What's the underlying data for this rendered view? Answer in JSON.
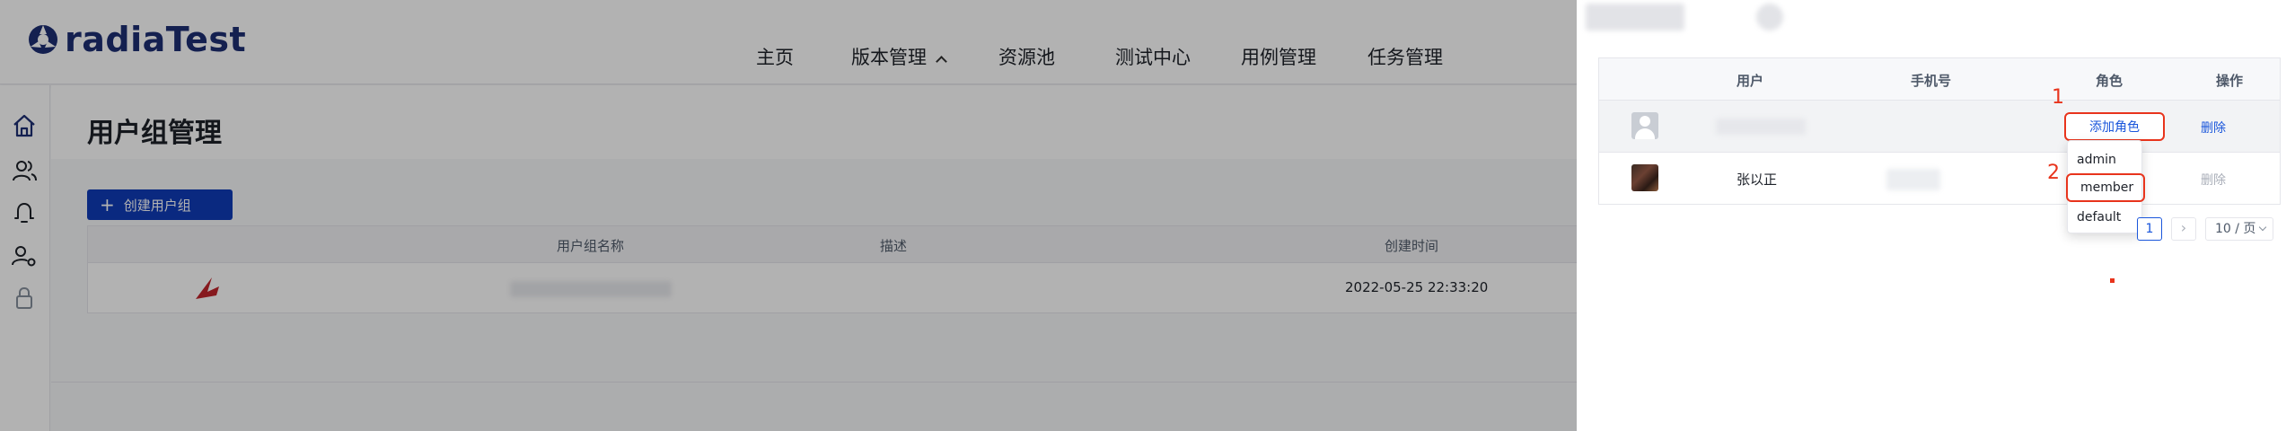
{
  "app": {
    "logo_text": "radiaTest",
    "brand_color": "#1d2e73",
    "accent_color": "#1a56db",
    "highlight_color": "#e8341c"
  },
  "nav": {
    "items": [
      {
        "label": "主页"
      },
      {
        "label": "版本管理",
        "has_caret": true
      },
      {
        "label": "资源池"
      },
      {
        "label": "测试中心"
      },
      {
        "label": "用例管理"
      },
      {
        "label": "任务管理"
      }
    ]
  },
  "sidebar": {
    "icons": [
      "home-icon",
      "users-icon",
      "bell-icon",
      "user-settings-icon",
      "lock-icon"
    ]
  },
  "page": {
    "title": "用户组管理",
    "create_button": "创建用户组",
    "table": {
      "columns": [
        "用户组名称",
        "描述",
        "创建时间"
      ],
      "rows": [
        {
          "created_at": "2022-05-25 22:33:20"
        }
      ]
    }
  },
  "drawer": {
    "table": {
      "columns": [
        "用户",
        "手机号",
        "角色",
        "操作"
      ],
      "rows": [
        {
          "name": "",
          "role_action": "添加角色",
          "action": "删除",
          "action_enabled": true,
          "avatar": "default-avatar-icon"
        },
        {
          "name": "张以正",
          "role_action": "",
          "action": "删除",
          "action_enabled": false,
          "avatar": "user-photo-avatar"
        }
      ]
    },
    "role_dropdown": {
      "options": [
        "admin",
        "member",
        "default"
      ],
      "highlighted": "member"
    },
    "annotations": [
      "1",
      "2"
    ],
    "pagination": {
      "current_page": "1",
      "page_size": "10 / 页"
    }
  }
}
